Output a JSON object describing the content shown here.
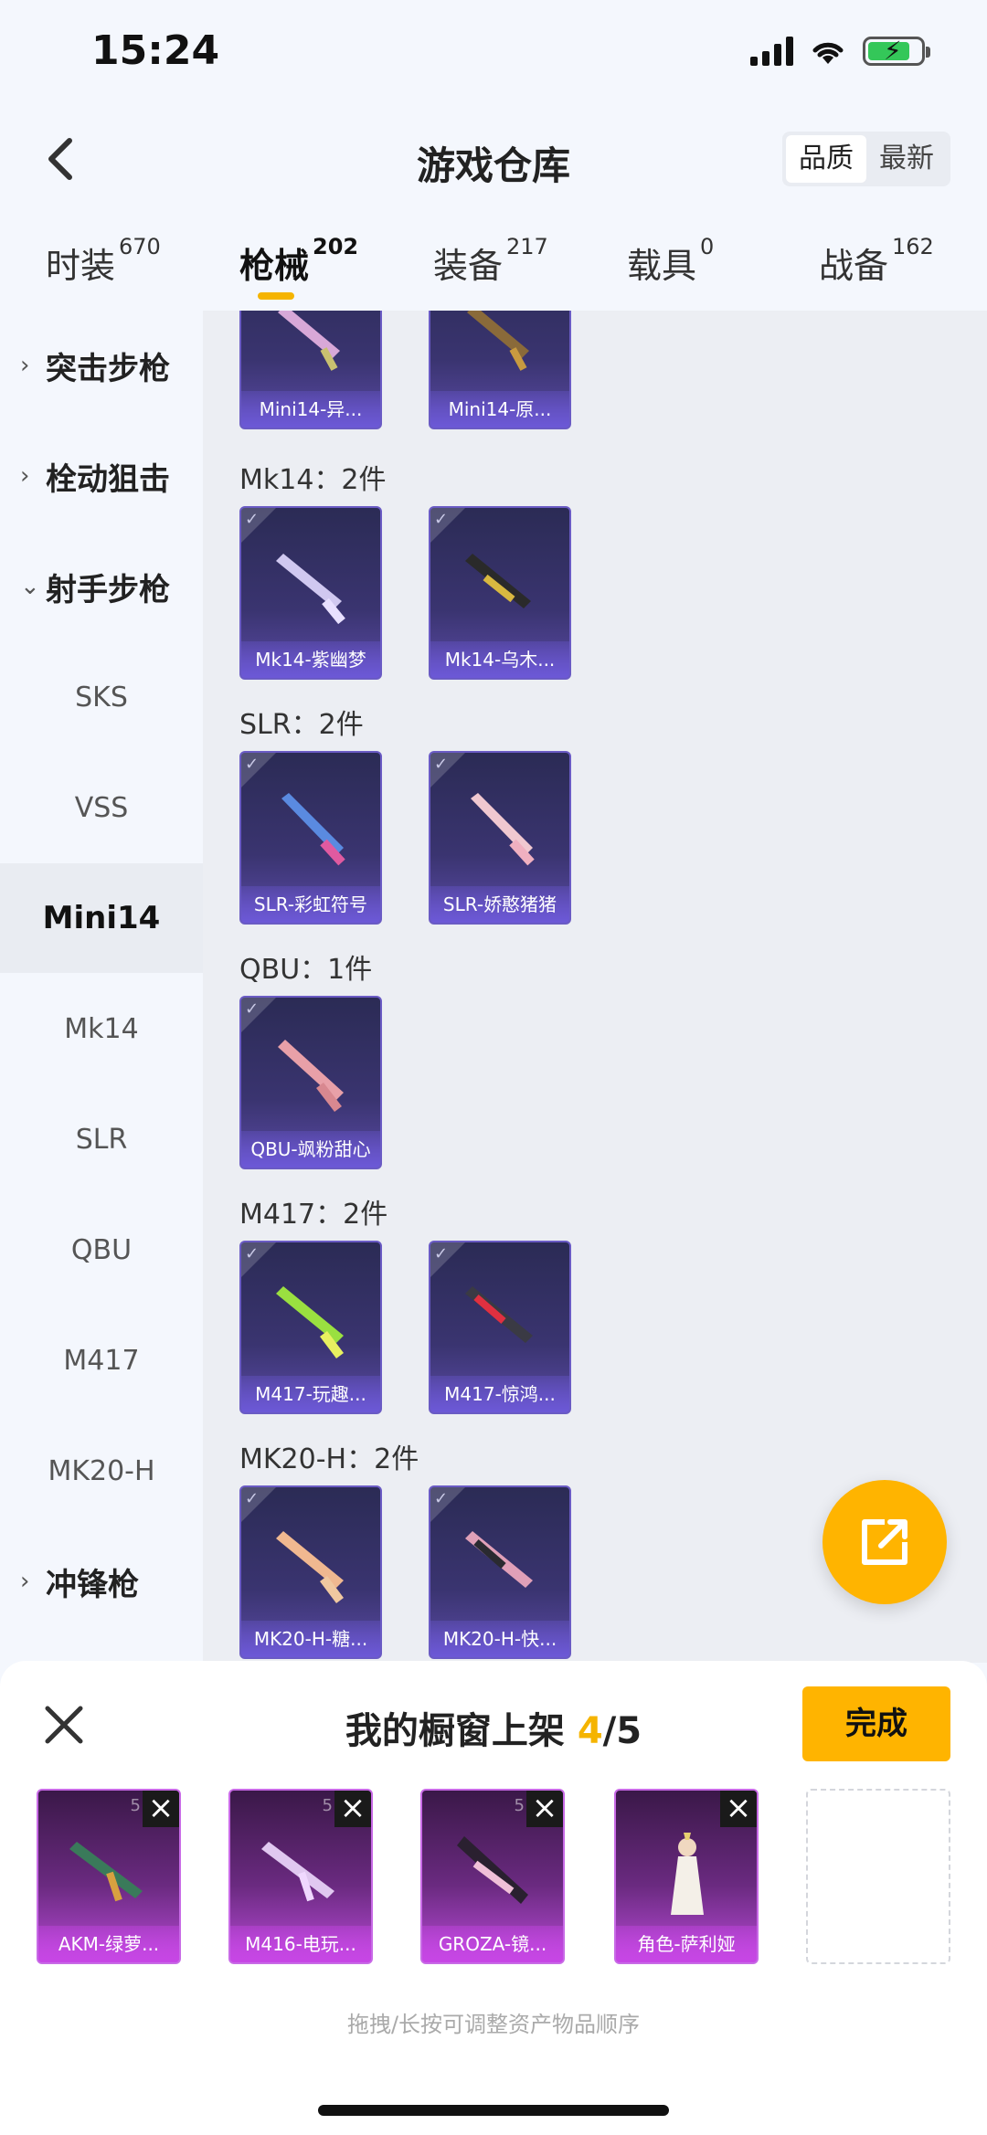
{
  "status": {
    "time": "15:24"
  },
  "header": {
    "title": "游戏仓库",
    "sort_quality": "品质",
    "sort_newest": "最新"
  },
  "tabs": [
    {
      "label": "时装",
      "count": "670"
    },
    {
      "label": "枪械",
      "count": "202"
    },
    {
      "label": "装备",
      "count": "217"
    },
    {
      "label": "载具",
      "count": "0"
    },
    {
      "label": "战备",
      "count": "162"
    }
  ],
  "sidebar": {
    "groups": [
      "突击步枪",
      "栓动狙击",
      "射手步枪",
      "冲锋枪"
    ],
    "items": [
      "SKS",
      "VSS",
      "Mini14",
      "Mk14",
      "SLR",
      "QBU",
      "M417",
      "MK20-H"
    ]
  },
  "sections": [
    {
      "label": "Mk14：2件",
      "cards": [
        "Mk14-紫幽梦",
        "Mk14-乌木..."
      ]
    },
    {
      "label": "SLR：2件",
      "cards": [
        "SLR-彩虹符号",
        "SLR-娇憨猪猪"
      ]
    },
    {
      "label": "QBU：1件",
      "cards": [
        "QBU-飒粉甜心"
      ]
    },
    {
      "label": "M417：2件",
      "cards": [
        "M417-玩趣...",
        "M417-惊鸿..."
      ]
    },
    {
      "label": "MK20-H：2件",
      "cards": [
        "MK20-H-糖...",
        "MK20-H-快..."
      ]
    }
  ],
  "top_cards": [
    "Mini14-异...",
    "Mini14-原..."
  ],
  "shelf": {
    "title_prefix": "我的橱窗上架",
    "count": "4",
    "total": "/5",
    "done_label": "完成",
    "items": [
      "AKM-绿萝...",
      "M416-电玩...",
      "GROZA-镜...",
      "角色-萨利娅"
    ],
    "hint": "拖拽/长按可调整资产物品顺序"
  },
  "colors": {
    "accent": "#ffb400",
    "card_purple": "#6a5bc4",
    "shelf_magenta": "#c86ae6"
  }
}
